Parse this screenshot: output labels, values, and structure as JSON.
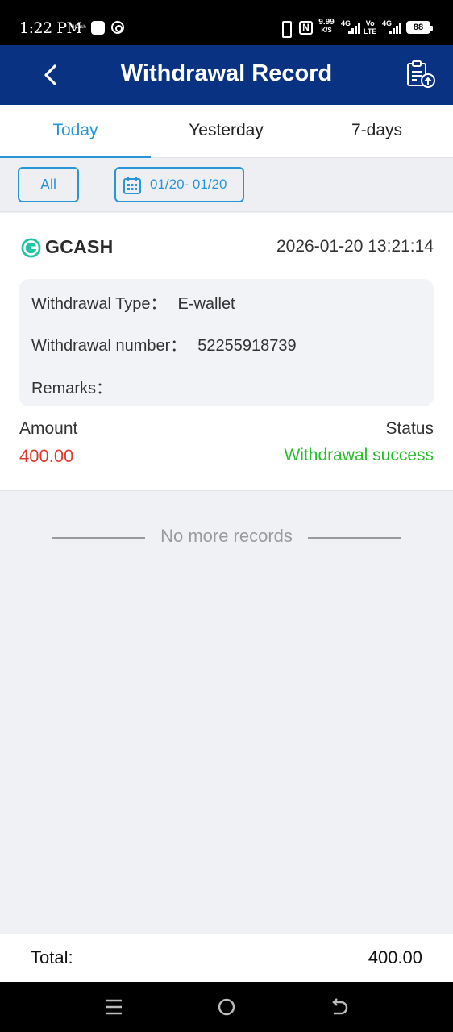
{
  "status_bar": {
    "time": "1:22 PM",
    "gcash_mini": "GCash",
    "speed": "9.99",
    "speed_unit": "K/S",
    "net1": "4G",
    "volte_top": "Vo",
    "volte_bottom": "LTE",
    "net2": "4G",
    "battery": "88",
    "icons": [
      "whatsapp-icon",
      "sync-icon",
      "vibrate-icon",
      "nfc-icon",
      "signal-icon",
      "battery-icon"
    ]
  },
  "header": {
    "title": "Withdrawal Record",
    "back_icon": "chevron-left-icon",
    "action_icon": "clipboard-upload-icon"
  },
  "tabs": [
    {
      "label": "Today",
      "active": true
    },
    {
      "label": "Yesterday",
      "active": false
    },
    {
      "label": "7-days",
      "active": false
    }
  ],
  "filters": {
    "all_label": "All",
    "date_range": "01/20- 01/20"
  },
  "record": {
    "brand": "GCASH",
    "datetime": "2026-01-20 13:21:14",
    "type_label": "Withdrawal Type：",
    "type_value": "E-wallet",
    "number_label": "Withdrawal number：",
    "number_value": "52255918739",
    "remarks_label": "Remarks：",
    "remarks_value": "",
    "amount_label": "Amount",
    "amount_value": "400.00",
    "status_label": "Status",
    "status_value": "Withdrawal success"
  },
  "footer_message": "No more records",
  "total": {
    "label": "Total:",
    "value": "400.00"
  },
  "colors": {
    "header_bg": "#0a3283",
    "accent": "#2a95d6",
    "amount": "#e03a2f",
    "success": "#26c02a"
  }
}
